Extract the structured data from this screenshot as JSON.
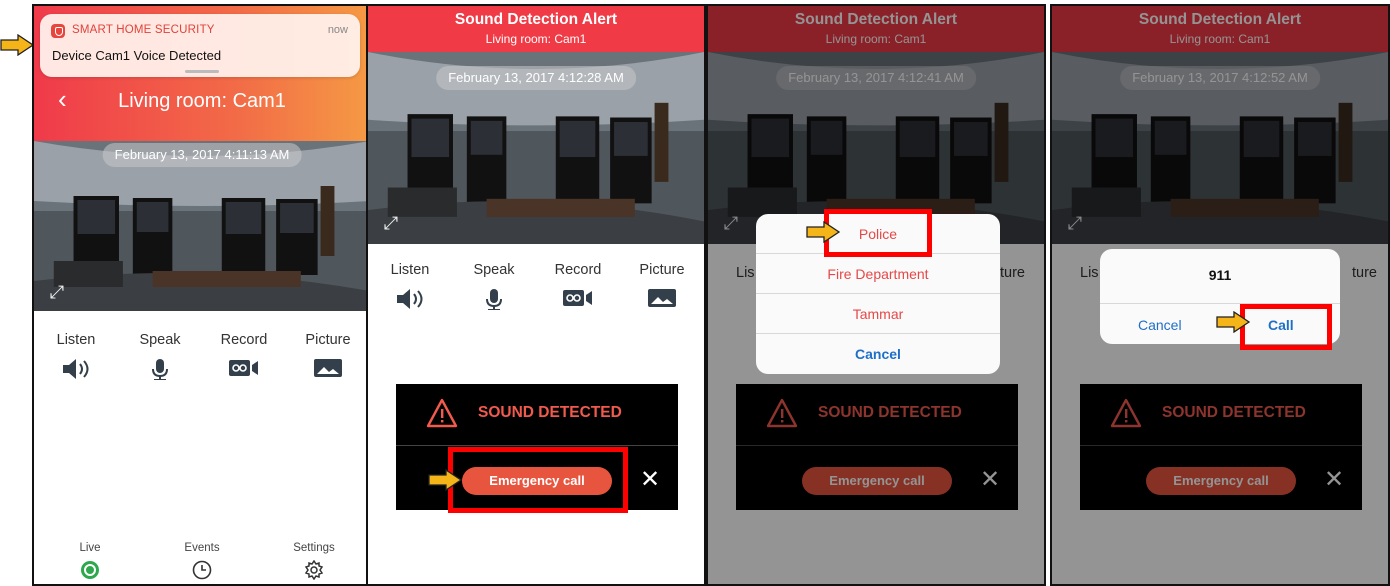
{
  "colors": {
    "brand_red": "#f03a45",
    "accent_blue": "#1f6fc7",
    "highlight": "#ff0000",
    "pointer": "#f5b417"
  },
  "panel1": {
    "notification": {
      "app": "SMART HOME SECURITY",
      "time": "now",
      "message": "Device Cam1 Voice Detected"
    },
    "back_icon": "chevron-left-icon",
    "title": "Living room: Cam1",
    "timestamp": "February 13, 2017 4:11:13 AM",
    "controls": [
      {
        "label": "Listen",
        "icon": "speaker-icon"
      },
      {
        "label": "Speak",
        "icon": "microphone-icon"
      },
      {
        "label": "Record",
        "icon": "record-icon"
      },
      {
        "label": "Picture",
        "icon": "picture-icon"
      }
    ],
    "tabs": [
      {
        "label": "Live",
        "icon": "live-icon"
      },
      {
        "label": "Events",
        "icon": "clock-icon"
      },
      {
        "label": "Settings",
        "icon": "gear-icon"
      }
    ]
  },
  "panel2": {
    "header_title": "Sound Detection Alert",
    "header_sub": "Living room: Cam1",
    "timestamp": "February 13, 2017 4:12:28 AM",
    "controls": [
      {
        "label": "Listen"
      },
      {
        "label": "Speak"
      },
      {
        "label": "Record"
      },
      {
        "label": "Picture"
      }
    ],
    "sound_title": "SOUND DETECTED",
    "emergency_label": "Emergency call"
  },
  "panel3": {
    "header_title": "Sound Detection Alert",
    "header_sub": "Living room: Cam1",
    "timestamp": "February 13, 2017 4:12:41 AM",
    "controls": [
      {
        "label": "Lis"
      },
      {
        "label": "ture"
      }
    ],
    "sheet": [
      "Police",
      "Fire Department",
      "Tammar",
      "Cancel"
    ],
    "sound_title": "SOUND DETECTED",
    "emergency_label": "Emergency call"
  },
  "panel4": {
    "header_title": "Sound Detection Alert",
    "header_sub": "Living room: Cam1",
    "timestamp": "February 13, 2017 4:12:52 AM",
    "controls": [
      {
        "label": "Lis"
      },
      {
        "label": "ture"
      }
    ],
    "dialog": {
      "number": "911",
      "cancel": "Cancel",
      "call": "Call"
    },
    "sound_title": "SOUND DETECTED",
    "emergency_label": "Emergency call"
  }
}
